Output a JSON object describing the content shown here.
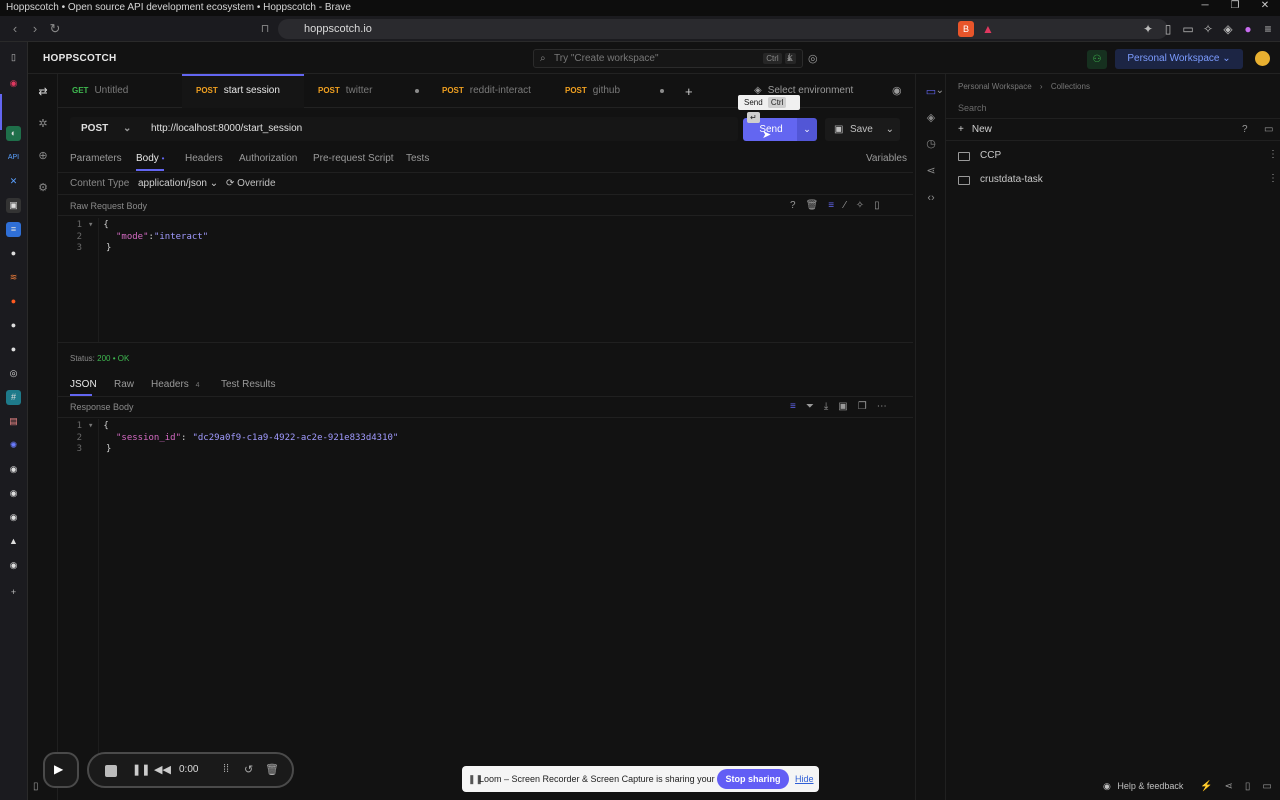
{
  "window": {
    "title": "Hoppscotch • Open source API development ecosystem • Hoppscotch - Brave"
  },
  "browser": {
    "url": "hoppscotch.io"
  },
  "app": {
    "logo": "HOPPSCOTCH",
    "search_placeholder": "Try \"Create workspace\"",
    "search_kbd": [
      "Ctrl",
      "K"
    ],
    "workspace": "Personal Workspace"
  },
  "tabs": [
    {
      "method": "GET",
      "name": "Untitled"
    },
    {
      "method": "POST",
      "name": "start session"
    },
    {
      "method": "POST",
      "name": "twitter"
    },
    {
      "method": "POST",
      "name": "reddit-interact"
    },
    {
      "method": "POST",
      "name": "github"
    }
  ],
  "environment": "Select environment",
  "request": {
    "method": "POST",
    "url": "http://localhost:8000/start_session",
    "send": "Send",
    "save": "Save",
    "tooltip": {
      "label": "Send",
      "kbd": "Ctrl",
      "enter": "↵"
    }
  },
  "request_tabs": [
    "Parameters",
    "Body",
    "Headers",
    "Authorization",
    "Pre-request Script",
    "Tests"
  ],
  "variables": "Variables",
  "content_type": {
    "label": "Content Type",
    "value": "application/json",
    "override": "Override"
  },
  "raw_body": {
    "title": "Raw Request Body",
    "lines": [
      {
        "n": "1",
        "text": "{"
      },
      {
        "n": "2",
        "key": "\"mode\"",
        "colon": ":",
        "value": "\"interact\""
      },
      {
        "n": "3",
        "text": "}"
      }
    ]
  },
  "status": {
    "label": "Status:",
    "code": "200",
    "sep": "•",
    "text": "OK"
  },
  "response_tabs": [
    "JSON",
    "Raw",
    "Headers",
    "Test Results"
  ],
  "response_headers_count": "4",
  "response_body": {
    "title": "Response Body",
    "lines": [
      {
        "n": "1",
        "text": "{"
      },
      {
        "n": "2",
        "key": "\"session_id\"",
        "colon": ":",
        "value": "\"dc29a0f9-c1a9-4922-ac2e-921e833d4310\""
      },
      {
        "n": "3",
        "text": "}"
      }
    ]
  },
  "collections": {
    "breadcrumb": [
      "Personal Workspace",
      "Collections"
    ],
    "search": "Search",
    "new": "New",
    "items": [
      "CCP",
      "crustdata-task"
    ]
  },
  "loom": {
    "message": "Loom – Screen Recorder & Screen Capture is sharing your screen.",
    "stop": "Stop sharing",
    "hide": "Hide",
    "timer": "0:00"
  },
  "footer": {
    "help": "Help & feedback"
  },
  "colors": {
    "accent": "#6366f1",
    "get": "#3fb950",
    "post": "#f0a020",
    "ok": "#3fb950"
  }
}
